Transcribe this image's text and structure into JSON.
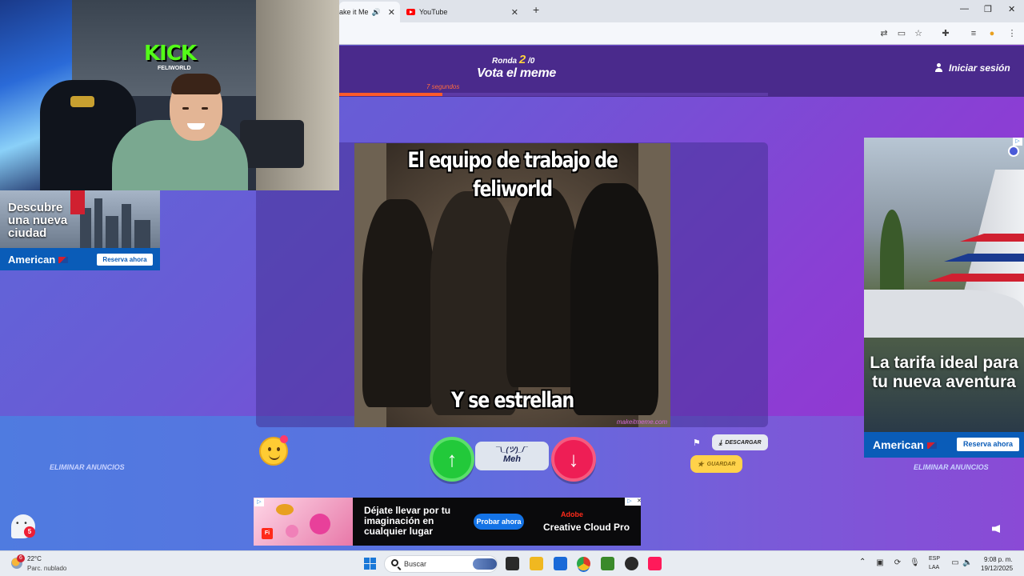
{
  "browser": {
    "tabs": [
      {
        "label": "ake it Me"
      },
      {
        "label": "YouTube"
      }
    ],
    "new_tab": "+",
    "window_controls": {
      "minimize": "—",
      "restore": "❐",
      "close": "✕"
    }
  },
  "game": {
    "round": {
      "label": "Ronda",
      "current": "2",
      "total": "/0"
    },
    "title": "Vota el meme",
    "timer": {
      "label": "7 segundos",
      "progress": 0.24
    },
    "login_label": "Iniciar sesión",
    "meme": {
      "top_text": "El equipo de trabajo de feliworld",
      "bottom_text": "Y se estrellan",
      "watermark": "makeitmeme.com"
    },
    "vote": {
      "up_symbol": "↑",
      "meh_face": "¯\\_(ツ)_/¯",
      "meh_label": "Meh",
      "down_symbol": "↓"
    },
    "download_label": "DESCARGAR",
    "save_label": "GUARDAR",
    "remove_ads_left": "ELIMINAR ANUNCIOS",
    "remove_ads_right": "ELIMINAR ANUNCIOS",
    "chat_badge": "5"
  },
  "ads": {
    "left": {
      "headline": "Descubre una nueva ciudad",
      "brand": "American",
      "cta": "Reserva ahora"
    },
    "right": {
      "headline": "La tarifa ideal para tu nueva aventura",
      "brand": "American",
      "cta": "Reserva ahora"
    },
    "bottom": {
      "badge": "Fi",
      "headline": "Déjate llevar por tu imaginación en cualquier lugar",
      "cta": "Probar ahora",
      "brand": "Adobe",
      "product": "Creative Cloud Pro"
    }
  },
  "webcam": {
    "kick": "KICK",
    "channel": "FELIWORLD"
  },
  "taskbar": {
    "weather": {
      "temp": "22°C",
      "desc": "Parc. nublado",
      "badge": "6"
    },
    "search_label": "Buscar",
    "lang_1": "ESP",
    "lang_2": "LAA",
    "time": "9:08 p. m.",
    "date": "19/12/2025"
  },
  "colors": {
    "accent_orange": "#ff5a2a",
    "vote_up": "#22c93a",
    "vote_down": "#ee1e55",
    "save_yellow": "#ffd24a",
    "round_yellow": "#ffd33d"
  }
}
